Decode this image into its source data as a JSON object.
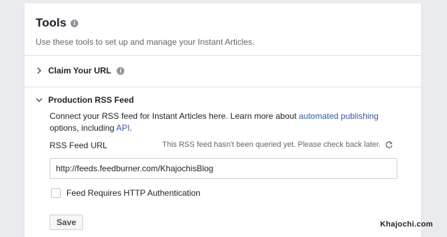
{
  "header": {
    "title": "Tools",
    "subtitle": "Use these tools to set up and manage your Instant Articles."
  },
  "sections": {
    "claim_url": {
      "label": "Claim Your URL",
      "expanded": false
    },
    "rss_feed": {
      "label": "Production RSS Feed",
      "expanded": true,
      "desc_part1": "Connect your RSS feed for Instant Articles here. Learn more about ",
      "desc_link1": "automated publishing",
      "desc_part2": " options, including ",
      "desc_link2": "API",
      "desc_part3": ".",
      "field_label": "RSS Feed URL",
      "status_text": "This RSS feed hasn't been queried yet. Please check back later.",
      "url_value": "http://feeds.feedburner.com/KhajochisBlog",
      "checkbox_label": "Feed Requires HTTP Authentication",
      "checkbox_checked": false,
      "save_label": "Save"
    }
  },
  "watermark": "Khajochi.com",
  "colors": {
    "background": "#e9ebee",
    "link": "#365899",
    "border": "#dddfe2",
    "text": "#1d2129",
    "muted": "#606770"
  },
  "icons": {
    "info": "info-icon",
    "collapsed": "chevron-right-icon",
    "expanded": "chevron-down-icon",
    "refresh": "refresh-icon"
  }
}
